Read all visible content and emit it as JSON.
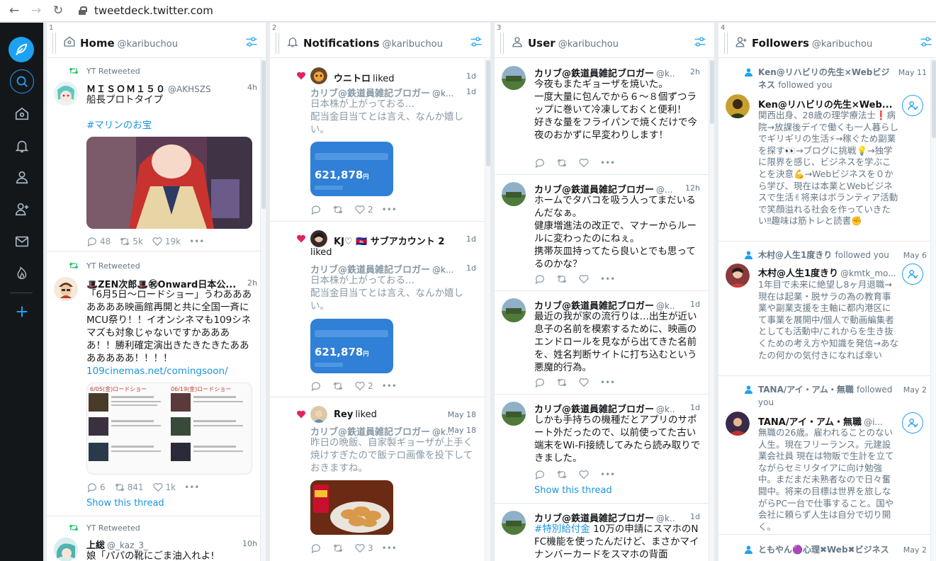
{
  "browser": {
    "url": "tweetdeck.twitter.com",
    "back_icon": "←",
    "forward_icon": "→",
    "reload_icon": "↻"
  },
  "colors": {
    "accent": "#1da1f2",
    "nav_bg": "#14171a",
    "like": "#e0245e",
    "retweet": "#17bf63"
  },
  "columns": [
    {
      "num": "1",
      "title": "Home",
      "user": "@karibuchou"
    },
    {
      "num": "2",
      "title": "Notifications",
      "user": "@karibuchou"
    },
    {
      "num": "3",
      "title": "User",
      "user": "@karibuchou"
    },
    {
      "num": "4",
      "title": "Followers",
      "user": "@karibuchou"
    }
  ],
  "home": [
    {
      "rt": "YT Retweeted",
      "name": "ＭＩＳＯＭ１５０",
      "handle": "@AKHSZS",
      "time": "4h",
      "text": "船長プロトタイプ",
      "hashtag": "#マリンのお宝",
      "replies": "48",
      "retweets": "5k",
      "likes": "19k"
    },
    {
      "rt": "YT Retweeted",
      "name": "🎩ZEN次郎🎩㊗Onward日本公...",
      "handle": "",
      "time": "2h",
      "text": "「6月5日～ロードショー」うわあああああああ映画館再開と共に全国一斉にMCU祭り！！イオンシネマも109シネマズも対象じゃないですかああああ！！勝利確定演出きたきたきたあああああああ！！！！",
      "link": "109cinemas.net/comingsoon/",
      "media_labels": [
        "6/05(金)ロードショー",
        "06/19(金)ロードショー"
      ],
      "replies": "6",
      "retweets": "841",
      "likes": "1k",
      "show_thread": "Show this thread"
    },
    {
      "rt": "YT Retweeted",
      "name": "上総",
      "handle": "@_kaz_3_",
      "time": "10h",
      "text": "娘「パパの靴にごま油入れよ!"
    }
  ],
  "notifications": [
    {
      "actor": "ウニトロ",
      "action": "liked",
      "time": "1d",
      "orig_name": "カリブ@鉄道員雑記ブロガー",
      "orig_handle": "@k...",
      "orig_time": "1d",
      "text": "日本株が上がっておる...\n配当金目当てとは言え、なんか嬉しい。",
      "media_value": "621,878",
      "media_unit": "円",
      "likes": "2"
    },
    {
      "actor": "KJ♡ 🇰🇭 サブアカウント 2",
      "action": "liked",
      "time": "1d",
      "orig_name": "カリブ@鉄道員雑記ブロガー",
      "orig_handle": "@k...",
      "orig_time": "1d",
      "text": "日本株が上がっておる...\n配当金目当てとは言え、なんか嬉しい。",
      "media_value": "621,878",
      "media_unit": "円",
      "likes": "2"
    },
    {
      "actor": "Rey",
      "action": "liked",
      "time": "May 18",
      "orig_name": "カリブ@鉄道員雑記ブロガー",
      "orig_handle": "@k...",
      "orig_time": "May 18",
      "text": "昨日の晩飯、自家製ギョーザが上手く焼けすぎたので飯テロ画像を投下しておきますね。",
      "likes": "3"
    }
  ],
  "user_tweets": [
    {
      "name": "カリブ@鉄道員雑記ブロガー",
      "handle": "@k...",
      "time": "2h",
      "text": "今夜もまたギョーザを焼いた。\n一度大量に包んでから６～８個ずつラップに巻いて冷凍しておくと便利！\n好きな量をフライパンで焼くだけで今夜のおかずに早変わりします！"
    },
    {
      "name": "カリブ@鉄道員雑記ブロガー",
      "handle": "@...",
      "time": "12h",
      "text": "ホームでタバコを吸う人ってまだいるんだなぁ。\n健康増進法の改正で、マナーからルールに変わったのにねぇ。\n携帯灰皿持ってたら良いとでも思ってるのかな？"
    },
    {
      "name": "カリブ@鉄道員雑記ブロガー",
      "handle": "@k...",
      "time": "1d",
      "text": "最近の我が家の流行りは…出生が近い息子の名前を模索するために、映画のエンドロールを見ながら出てきた名前を、姓名判断サイトに打ち込むという悪魔的行為。"
    },
    {
      "name": "カリブ@鉄道員雑記ブロガー",
      "handle": "@k...",
      "time": "1d",
      "text": "しかも手持ちの機種だとアプリのサポート外だったので、以前使ってた古い端末をWi-Fi接続してみたら読み取りできました。",
      "show_thread": "Show this thread"
    },
    {
      "name": "カリブ@鉄道員雑記ブロガー",
      "handle": "@k...",
      "time": "1d",
      "hashtag": "#特別給付金",
      "text": " 10万の申請にスマホのNFC機能を使ったんだけど、まさかマイナンバーカードをスマホの背面"
    }
  ],
  "followers": [
    {
      "header": "Ken@リハビリの先生×Webビジネス",
      "followed": "followed you",
      "time": "May 11",
      "name": "Ken@リハビリの先生×Web...",
      "handle": "",
      "bio": "関西出身、28歳の理学療法士❗病院→放課後デイで働くも一人暮らしでギリギリの生活⚡→稼ぐため副業を探す👀→ブログに挑戦💡→独学に限界を感じ、ビジネスを学ぶことを決意💪→Webビジネスを０から学び、現在は本業とWebビジネスで生活✌将来はボランティア活動で笑顔溢れる社会を作っていきたい‼趣味は筋トレと読書✊"
    },
    {
      "header": "木村@人生1度きり",
      "followed": "followed you",
      "time": "May 6",
      "name": "木村@人生1度きり",
      "handle": "@kmtk_mo...",
      "bio": "1年目で未来に絶望し8ヶ月退職→現在は起業・脱サラの為の教育事業や副業支援を主軸に都内港区にて事業を展開中/個人で動画編集者としても活動中/これからを生き抜くための考え方や知識を発信→あなたの何かの気付きになれば幸い"
    },
    {
      "header": "TANA/アイ・アム・無職",
      "followed": "followed you",
      "time": "May 2",
      "name": "TANA/アイ・アム・無職",
      "handle": "@i...",
      "bio": "無職の26歳。雇われることのない人生。現在フリーランス。元建設業会社員 現在は物販で生計を立てながらセミリタイアに向け勉強中。まだまだ未熟者なので日々奮闘中。将来の目標は世界を旅しながらPC一台で仕事すること。国や会社に頼らず人生は自分で切り開く。"
    },
    {
      "header": "ともやん🟣心理✖Web✖ビジネス",
      "followed": "",
      "time": "May 2"
    }
  ]
}
